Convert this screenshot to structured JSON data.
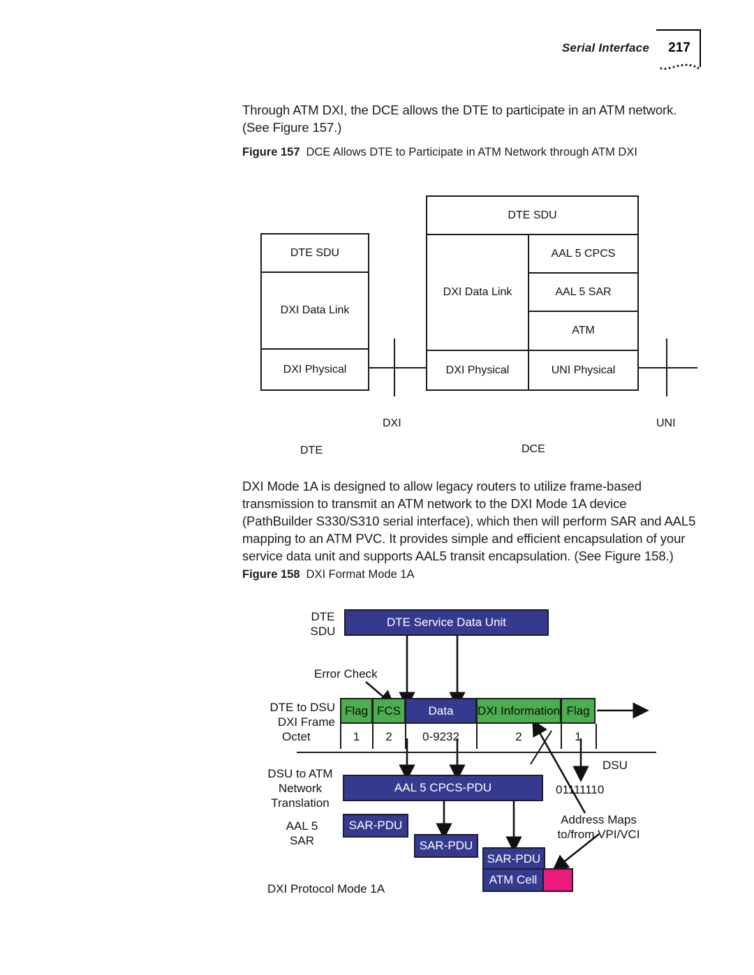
{
  "header": {
    "title": "Serial Interface",
    "page_number": "217"
  },
  "body": {
    "paragraph_1": "Through ATM DXI, the DCE allows the DTE to participate in an ATM network. (See Figure 157.)",
    "paragraph_2": "DXI Mode 1A is designed to allow legacy routers to utilize frame-based transmission to transmit an ATM network to the DXI Mode 1A device (PathBuilder S330/S310 serial interface), which then will perform SAR and AAL5 mapping to an ATM PVC. It provides simple and efficient encapsulation of your service data unit and supports AAL5 transit encapsulation. (See Figure 158.)"
  },
  "figure_157": {
    "caption_label": "Figure 157",
    "caption_text": "DCE Allows DTE to Participate in ATM Network through ATM DXI",
    "dte_stack": [
      "DTE SDU",
      "DXI Data Link",
      "DXI Physical"
    ],
    "dce_stack": {
      "top": "DTE SDU",
      "left_column": "DXI Data Link",
      "right_column": [
        "AAL  5 CPCS",
        "AAL  5 SAR",
        "ATM"
      ],
      "bottom_left": "DXI Physical",
      "bottom_right": "UNI Physical"
    },
    "interface_labels": {
      "dxi": "DXI",
      "uni": "UNI"
    },
    "device_labels": {
      "dte": "DTE",
      "dce": "DCE"
    }
  },
  "figure_158": {
    "caption_label": "Figure 158",
    "caption_text": "DXI Format Mode 1A",
    "row_labels": {
      "dte_sdu": "DTE\nSDU",
      "dxi_frame": "DTE to DSU\nDXI Frame",
      "octet": "Octet",
      "translation": "DSU to ATM\nNetwork\nTranslation",
      "aal5_sar": "AAL 5\nSAR",
      "protocol": "DXI Protocol Mode 1A"
    },
    "sdu_box": "DTE Service Data Unit",
    "error_check": "Error Check",
    "frame_cells": [
      {
        "label": "Flag",
        "octet": "1",
        "color": "green"
      },
      {
        "label": "FCS",
        "octet": "2",
        "color": "green"
      },
      {
        "label": "Data",
        "octet": "0-9232",
        "color": "blue"
      },
      {
        "label": "DXI Information",
        "octet": "2",
        "color": "green"
      },
      {
        "label": "Flag",
        "octet": "1",
        "color": "green"
      }
    ],
    "cpcs_box": "AAL 5 CPCS-PDU",
    "sar_boxes": [
      "SAR-PDU",
      "SAR-PDU",
      "SAR-PDU"
    ],
    "atm_cell": "ATM Cell",
    "dsu_label": "DSU",
    "flag_bits": "01111110",
    "address_maps": "Address Maps\nto/from VPI/VCI",
    "colors": {
      "blue": "#363a8e",
      "green": "#4cae4f",
      "pink": "#ec1a7c"
    }
  }
}
